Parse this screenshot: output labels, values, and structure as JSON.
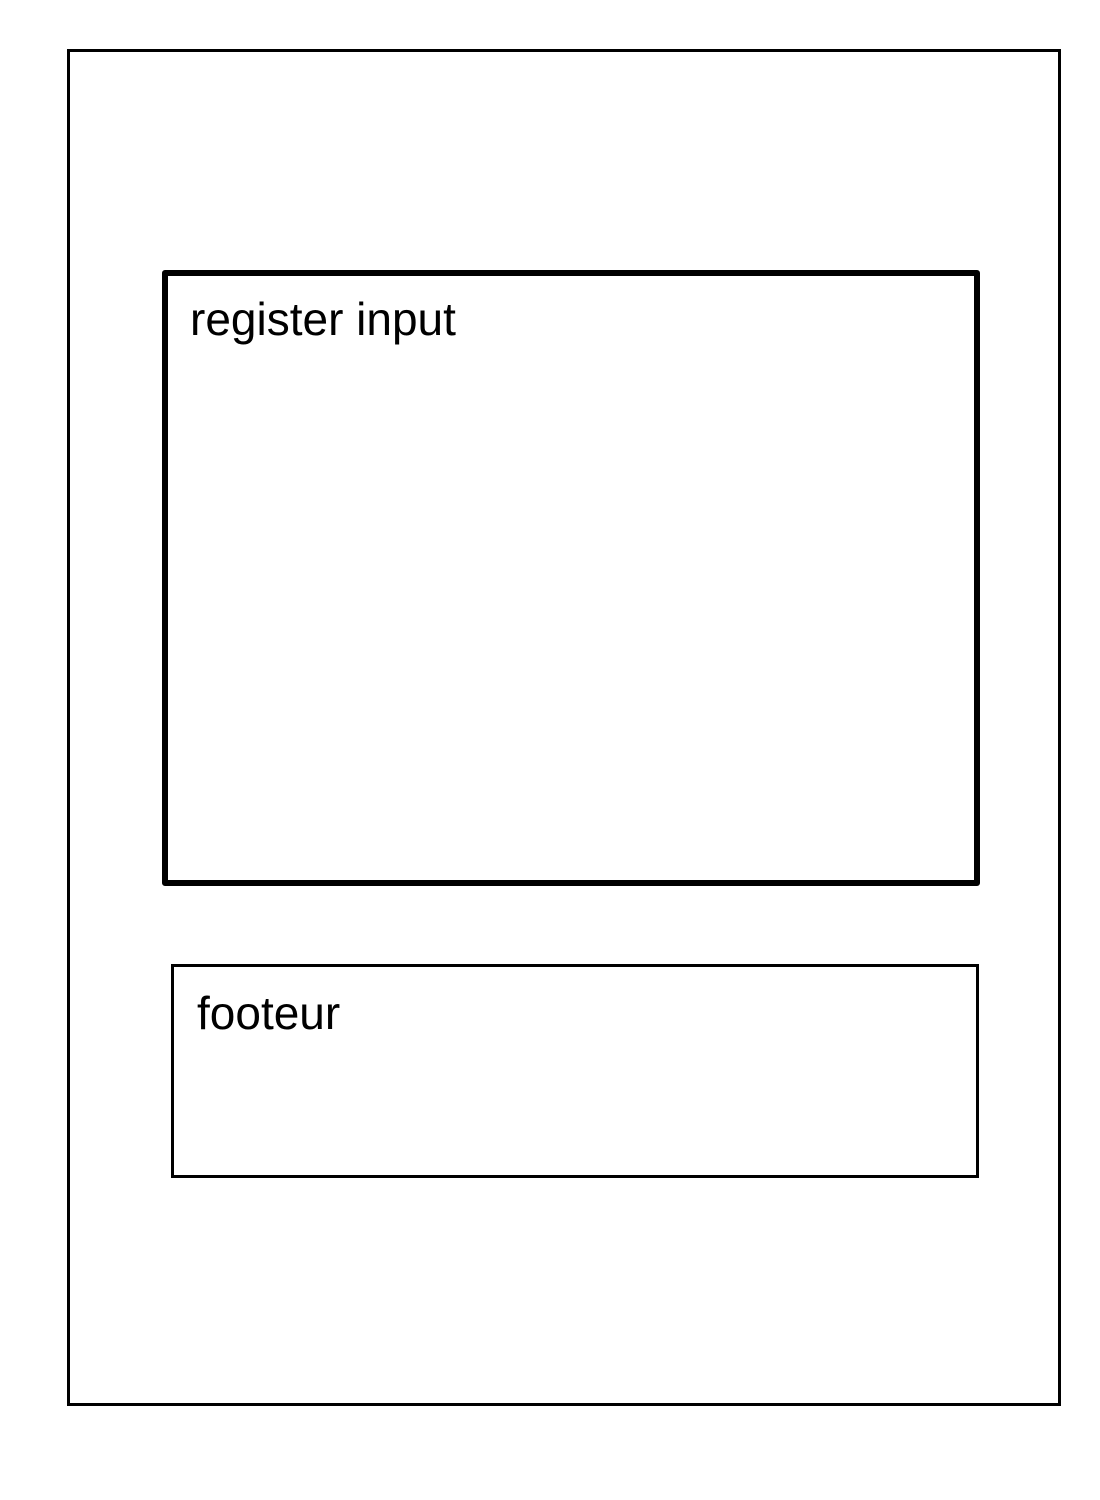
{
  "wireframe": {
    "register_section": {
      "label": "register input"
    },
    "footer_section": {
      "label": "footeur"
    }
  }
}
